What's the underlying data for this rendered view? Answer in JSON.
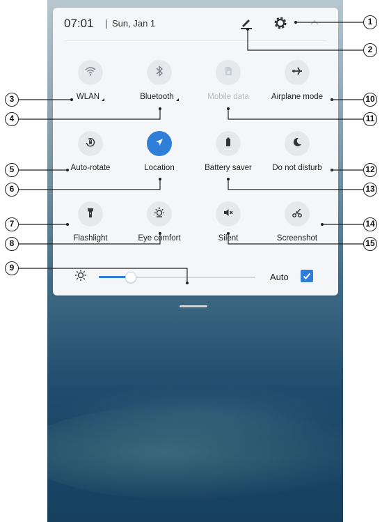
{
  "status": {
    "time": "07:01",
    "separator": "|",
    "date": "Sun, Jan 1"
  },
  "tiles": [
    {
      "id": "wlan",
      "label": "WLAN",
      "icon": "wifi-icon",
      "active": false,
      "disabled": false,
      "expandable": true
    },
    {
      "id": "bluetooth",
      "label": "Bluetooth",
      "icon": "bluetooth-icon",
      "active": false,
      "disabled": false,
      "expandable": true
    },
    {
      "id": "mobile-data",
      "label": "Mobile data",
      "icon": "sim-card-icon",
      "active": false,
      "disabled": true,
      "expandable": false
    },
    {
      "id": "airplane",
      "label": "Airplane mode",
      "icon": "airplane-icon",
      "active": false,
      "disabled": false,
      "expandable": false
    },
    {
      "id": "auto-rotate",
      "label": "Auto-rotate",
      "icon": "rotate-lock-icon",
      "active": false,
      "disabled": false,
      "expandable": false
    },
    {
      "id": "location",
      "label": "Location",
      "icon": "location-arrow-icon",
      "active": true,
      "disabled": false,
      "expandable": false
    },
    {
      "id": "battery-saver",
      "label": "Battery saver",
      "icon": "battery-icon",
      "active": false,
      "disabled": false,
      "expandable": false
    },
    {
      "id": "dnd",
      "label": "Do not disturb",
      "icon": "moon-icon",
      "active": false,
      "disabled": false,
      "expandable": false
    },
    {
      "id": "flashlight",
      "label": "Flashlight",
      "icon": "flashlight-icon",
      "active": false,
      "disabled": false,
      "expandable": false
    },
    {
      "id": "eye-comfort",
      "label": "Eye comfort",
      "icon": "eye-comfort-sun-icon",
      "active": false,
      "disabled": false,
      "expandable": false
    },
    {
      "id": "silent",
      "label": "Silent",
      "icon": "speaker-muted-icon",
      "active": false,
      "disabled": false,
      "expandable": false
    },
    {
      "id": "screenshot",
      "label": "Screenshot",
      "icon": "scissors-icon",
      "active": false,
      "disabled": false,
      "expandable": false
    }
  ],
  "brightness": {
    "icon": "brightness-sun-icon",
    "level": 0.2,
    "auto_label": "Auto",
    "auto_checked": true
  },
  "callouts": [
    "1",
    "2",
    "3",
    "4",
    "5",
    "6",
    "7",
    "8",
    "9",
    "10",
    "11",
    "12",
    "13",
    "14",
    "15"
  ],
  "colors": {
    "accent": "#2f7ed8",
    "panel": "#f5f6f7",
    "tile_bg": "#e6e9ec",
    "disabled_text": "#b6bbc0"
  }
}
